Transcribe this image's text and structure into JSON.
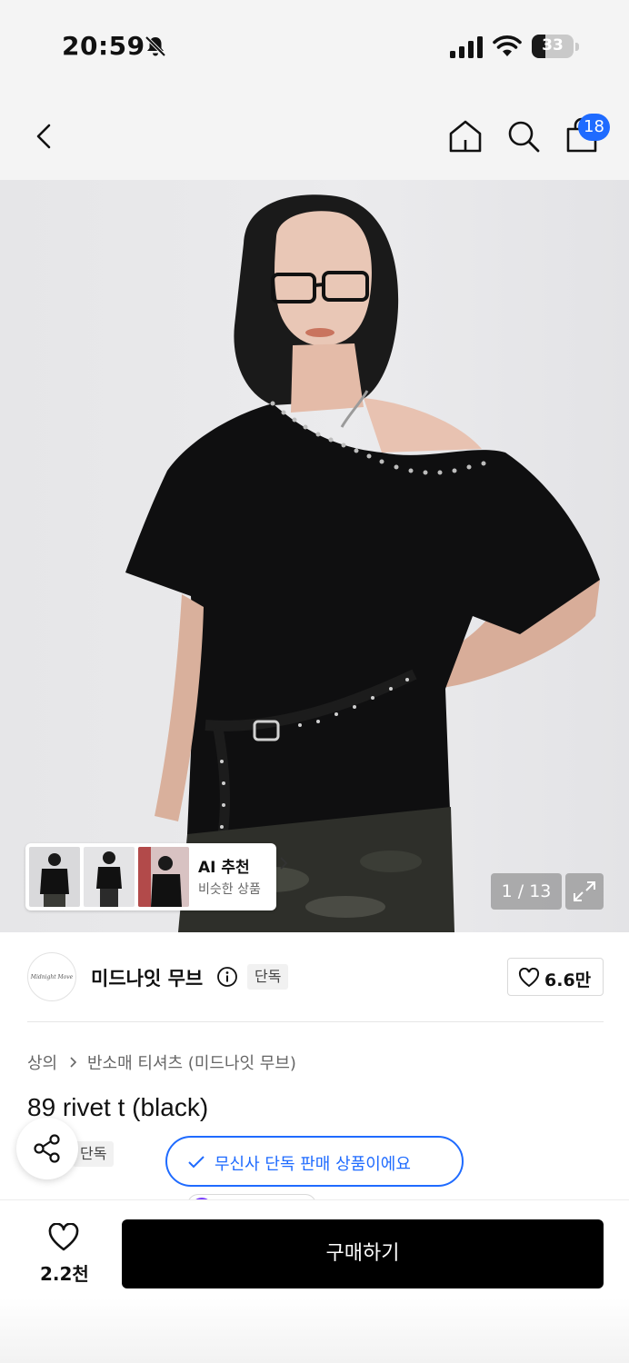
{
  "status_bar": {
    "time": "20:59",
    "battery_level": "33",
    "battery_fraction": 0.33
  },
  "nav": {
    "cart_count": "18",
    "badge_color": "#1f6bff"
  },
  "gallery": {
    "counter": "1 / 13",
    "ai_title": "AI 추천",
    "ai_subtitle": "비슷한 상품"
  },
  "brand": {
    "logo_text": "Midnight Move",
    "name": "미드나잇 무브",
    "exclusive_tag": "단독",
    "likes": "6.6만"
  },
  "breadcrumb": {
    "items": [
      "상의",
      "반소매 티셔츠 (미드나잇 무브)"
    ]
  },
  "product": {
    "title": "89 rivet t (black)",
    "exclusive_tag": "단독",
    "exclusive_notice": "무신사 단독 판매 상품이에요"
  },
  "bottom_bar": {
    "like_count": "2.2천",
    "buy_label": "구매하기"
  },
  "icons": [
    "bell-slash-icon",
    "signal-icon",
    "wifi-icon",
    "battery-icon",
    "back-chevron-icon",
    "home-icon",
    "search-icon",
    "shopping-bag-icon",
    "expand-icon",
    "info-icon",
    "heart-icon",
    "share-icon",
    "check-icon",
    "chevron-right-icon"
  ]
}
